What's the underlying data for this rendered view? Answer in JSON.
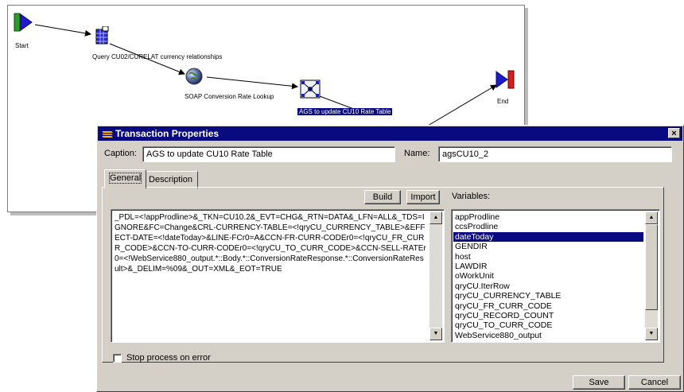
{
  "workflow": {
    "start_label": "Start",
    "query_label": "Query CU02/CURELAT currency relationships",
    "soap_label": "SOAP Conversion Rate Lookup",
    "ags_label": "AGS to update CU10 Rate Table",
    "end_label": "End"
  },
  "dialog": {
    "title": "Transaction Properties",
    "close_label": "×",
    "caption_label": "Caption:",
    "caption_value": "AGS to update CU10 Rate Table",
    "name_label": "Name:",
    "name_value": "agsCU10_2",
    "tabs": [
      {
        "label": "General",
        "active": true
      },
      {
        "label": "Description",
        "active": false
      }
    ],
    "build_label": "Build",
    "import_label": "Import",
    "variables_label": "Variables:",
    "body_text": "_PDL=<!appProdline>&_TKN=CU10.2&_EVT=CHG&_RTN=DATA&_LFN=ALL&_TDS=IGNORE&FC=Change&CRL-CURRENCY-TABLE=<!qryCU_CURRENCY_TABLE>&EFFECT-DATE=<!dateToday>&LINE-FCr0=A&CCN-FR-CURR-CODEr0=<!qryCU_FR_CURR_CODE>&CCN-TO-CURR-CODEr0=<!qryCU_TO_CURR_CODE>&CCN-SELL-RATEr0=<!WebService880_output.*::Body.*::ConversionRateResponse.*::ConversionRateResult>&_DELIM=%09&_OUT=XML&_EOT=TRUE",
    "variables": [
      "appProdline",
      "ccsProdline",
      "dateToday",
      "GENDIR",
      "host",
      "LAWDIR",
      "oWorkUnit",
      "qryCU.IterRow",
      "qryCU_CURRENCY_TABLE",
      "qryCU_FR_CURR_CODE",
      "qryCU_RECORD_COUNT",
      "qryCU_TO_CURR_CODE",
      "WebService880_output"
    ],
    "selected_variable_index": 2,
    "stop_on_error_label": "Stop process on error",
    "stop_on_error_checked": false,
    "save_label": "Save",
    "cancel_label": "Cancel"
  },
  "colors": {
    "title_bar": "#0a0a80",
    "selection": "#0a0a80",
    "dialog_face": "#d4d0c8",
    "start_green": "#2e9a2e",
    "end_red": "#d02020",
    "flag_blue": "#1c1cc8"
  },
  "icons": {
    "start": "start-flag-icon",
    "query": "database-grid-icon",
    "soap": "globe-icon",
    "ags": "network-node-icon",
    "end": "end-flag-icon",
    "title": "transaction-icon"
  }
}
